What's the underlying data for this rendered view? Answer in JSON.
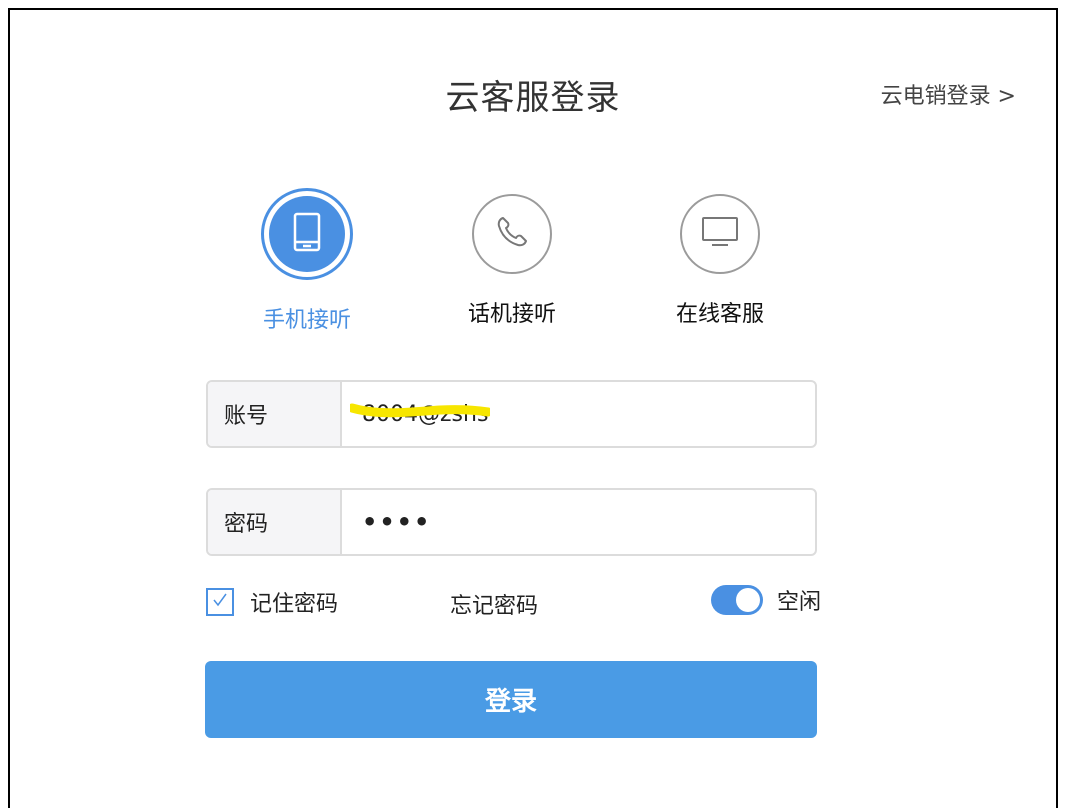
{
  "header": {
    "title": "云客服登录",
    "alt_login": "云电销登录 >"
  },
  "modes": [
    {
      "label": "手机接听",
      "icon": "mobile-phone-icon",
      "active": true
    },
    {
      "label": "话机接听",
      "icon": "telephone-handset-icon",
      "active": false
    },
    {
      "label": "在线客服",
      "icon": "monitor-icon",
      "active": false
    }
  ],
  "form": {
    "account_label": "账号",
    "account_value": "8004@zshs",
    "password_label": "密码",
    "password_value": "••••",
    "remember_label": "记住密码",
    "remember_checked": true,
    "forgot_label": "忘记密码",
    "status_label": "空闲",
    "status_on": true,
    "submit_label": "登录"
  },
  "colors": {
    "accent": "#4a90e2",
    "button": "#4a9be5",
    "highlight": "#f7e600"
  }
}
